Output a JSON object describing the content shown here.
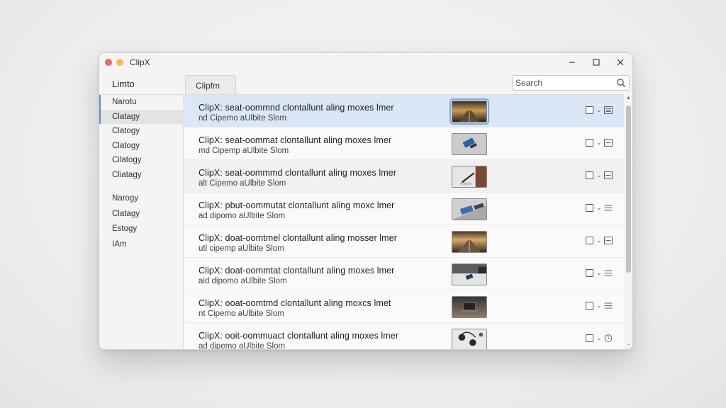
{
  "window": {
    "title": "ClipX",
    "controls": {
      "minimize": "minimize-icon",
      "maximize": "maximize-icon",
      "close": "close-icon"
    }
  },
  "sidebar": {
    "heading": "Limto",
    "groups": [
      {
        "items": [
          {
            "label": "Narotu"
          },
          {
            "label": "Clatagy",
            "active": true
          },
          {
            "label": "Clatogy"
          },
          {
            "label": "Clatogy"
          },
          {
            "label": "Cilatogy"
          },
          {
            "label": "Cliatagy"
          }
        ]
      },
      {
        "items": [
          {
            "label": "Narogy"
          },
          {
            "label": "Clatagy"
          },
          {
            "label": "Estogy"
          },
          {
            "label": "IAm"
          }
        ]
      }
    ]
  },
  "tab": {
    "label": "Clipfm"
  },
  "search": {
    "placeholder": "Search",
    "value": "",
    "icon": "search-icon"
  },
  "list": {
    "rows": [
      {
        "title": "ClipX: seat-oommnd clontallunt aling moxes lmer",
        "subtitle": "nd Cipemo aUlbite Slom",
        "thumb": "sunset-road",
        "selected": true,
        "menu_icon": "list-icon"
      },
      {
        "title": "ClipX: seat-oommat clontallunt aling moxes lmer",
        "subtitle": "md Cipemp aUlbite Slom",
        "thumb": "phone-desk",
        "menu_icon": "list-icon"
      },
      {
        "title": "ClipX: seat-oommmd clontallunt aling moxes lmer",
        "subtitle": "alt Cipemo aUlbite Slom",
        "thumb": "pen-desk",
        "menu_icon": "list-icon"
      },
      {
        "title": "ClipX: pbut-oommutat clontallunt aling moxc lmer",
        "subtitle": "ad dipomo aUlbite Slom",
        "thumb": "phone-angle",
        "menu_icon": "list-icon"
      },
      {
        "title": "ClipX: doat-oomtmel clontallunt aling mosser lmer",
        "subtitle": "utl cipemp aUlbite Slom",
        "thumb": "road-warm",
        "menu_icon": "list-icon"
      },
      {
        "title": "ClipX: doat-oommtat clontallunt aling moxes lmer",
        "subtitle": "aid dipomo aUlbite Slom",
        "thumb": "device-dark",
        "menu_icon": "list-icon"
      },
      {
        "title": "ClipX: ooat-oomtmd clontallunt aling moxcs lmet",
        "subtitle": "nt Cipemo aUlbite Slom",
        "thumb": "laptop",
        "menu_icon": "list-icon"
      },
      {
        "title": "ClipX: ooit-oommuact clontallunt aling moxes lmer",
        "subtitle": "ad dipemo aUlbite Slom",
        "thumb": "headphones",
        "menu_icon": "clock-icon"
      }
    ]
  },
  "colors": {
    "accent": "#5b8de0",
    "selected_row": "#dbe6f7",
    "close_dot": "#ec6a5e",
    "min_dot": "#f4bf4f"
  }
}
